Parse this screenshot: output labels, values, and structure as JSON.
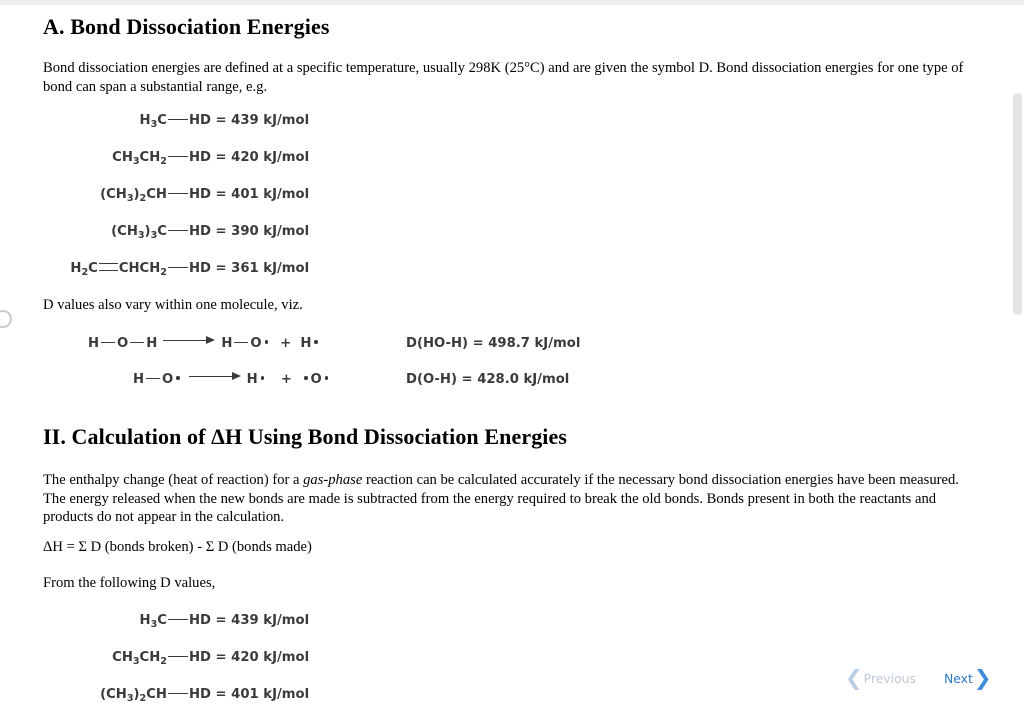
{
  "document": {
    "section_a": {
      "heading": "A. Bond Dissociation Energies",
      "intro": "Bond dissociation energies are defined at a specific temperature, usually 298K (25°C) and are given the symbol D. Bond dissociation energies for one type of bond can span a substantial range, e.g.",
      "bond_table": [
        {
          "value": "D  =  439 kJ/mol"
        },
        {
          "value": "D  =  420 kJ/mol"
        },
        {
          "value": "D  =  401 kJ/mol"
        },
        {
          "value": "D  =  390 kJ/mol"
        },
        {
          "value": "D  =  361 kJ/mol"
        }
      ],
      "viz_text": "D values also vary within one molecule, viz.",
      "reactions": [
        {
          "value": "D(HO-H)  =  498.7 kJ/mol"
        },
        {
          "value": "D(O-H)  =  428.0 kJ/mol"
        }
      ]
    },
    "section_ii": {
      "heading": "II. Calculation of ΔH Using Bond Dissociation Energies",
      "paragraph_pre": "The enthalpy change (heat of reaction) for a ",
      "paragraph_italic": "gas-phase",
      "paragraph_post": " reaction can be calculated accurately if the necessary bond dissociation energies have been measured. The energy released when the new bonds are made is subtracted from the energy required to break the old bonds. Bonds present in both the reactants and products do not appear in the calculation.",
      "equation": "ΔH = Σ D (bonds broken) - Σ D (bonds made)",
      "from_values_text": "From the following D values,",
      "bond_table": [
        {
          "value": "D  =  439 kJ/mol"
        },
        {
          "value": "D  =  420 kJ/mol"
        },
        {
          "value": "D  =  401 kJ/mol"
        }
      ]
    }
  },
  "chem": {
    "H": "H",
    "C": "C",
    "O": "O",
    "CH": "CH",
    "sub2": "2",
    "sub3": "3",
    "paren_open": "(",
    "paren_close": ")",
    "plus": "+"
  },
  "navigation": {
    "previous_label": "Previous",
    "next_label": "Next",
    "previous_chevron": "❮",
    "next_chevron": "❯"
  },
  "colors": {
    "next_text": "#2c78c4",
    "next_chevron": "#3f8ddb",
    "previous_text": "#bdc9d6",
    "previous_chevron": "#b9cde4",
    "chem_text": "#3a3a3a",
    "body_text": "#000000",
    "scrollbar_thumb": "#e4e4e4"
  }
}
